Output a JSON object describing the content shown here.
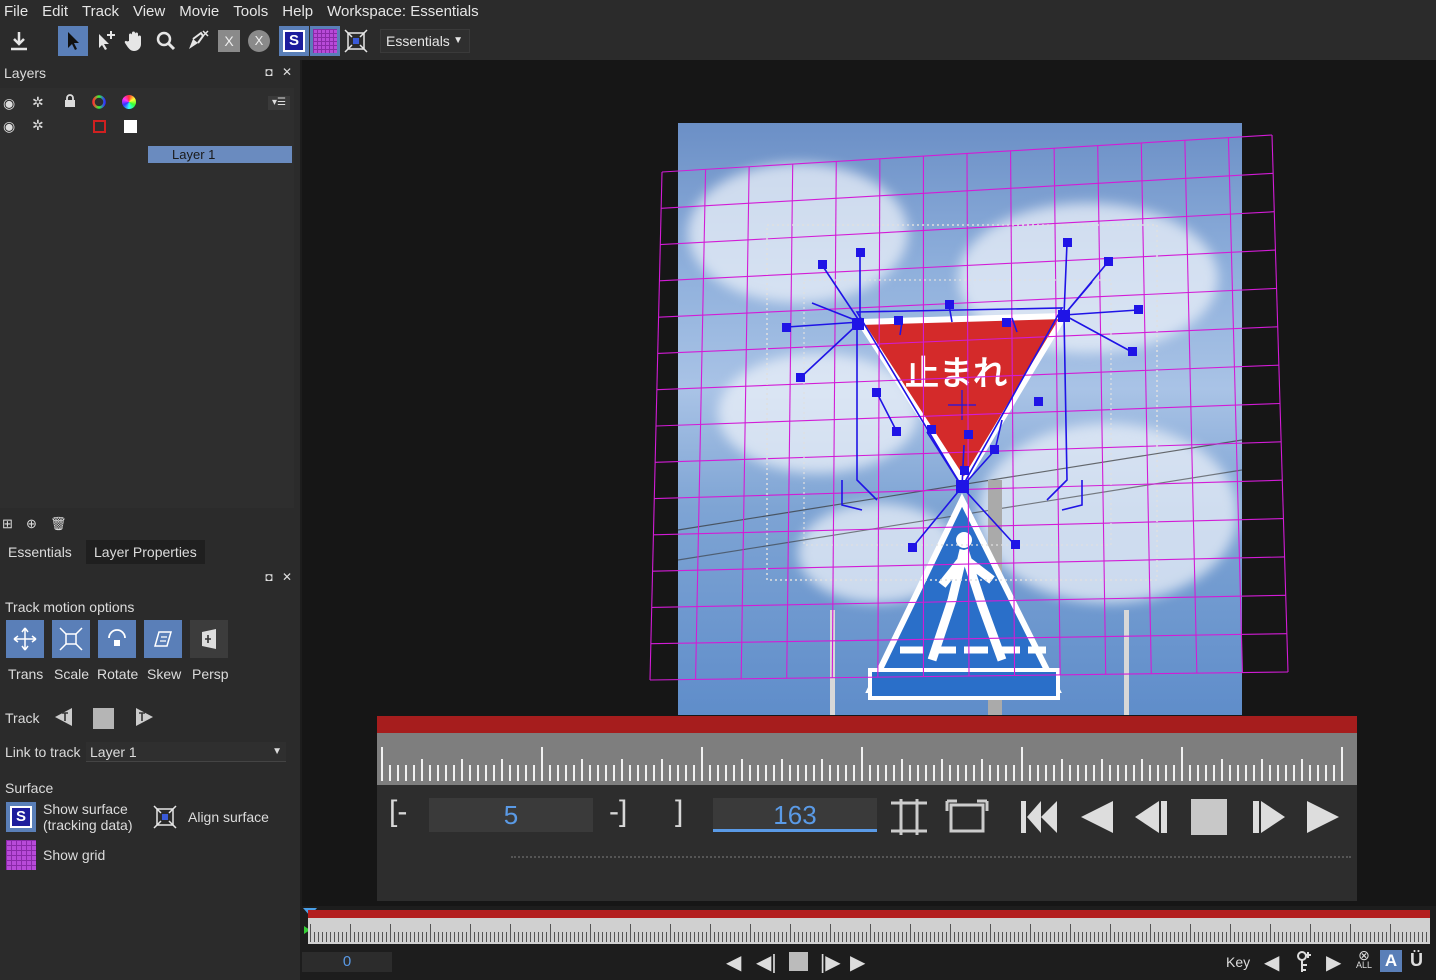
{
  "menu": {
    "file": "File",
    "edit": "Edit",
    "track": "Track",
    "view": "View",
    "movie": "Movie",
    "tools": "Tools",
    "help": "Help",
    "workspace": "Workspace: Essentials"
  },
  "toolbar": {
    "workspace_select": "Essentials",
    "icons": [
      "export-icon",
      "select-icon",
      "add-point-icon",
      "hand-icon",
      "zoom-icon",
      "pen-icon",
      "x-square-icon",
      "x-circle-icon",
      "show-surface-icon",
      "show-grid-icon",
      "align-surface-icon"
    ]
  },
  "layers_panel": {
    "title": "Layers",
    "layers": [
      {
        "name": "Layer 1",
        "selected": true
      }
    ]
  },
  "tabs": {
    "essentials": "Essentials",
    "layer_properties": "Layer Properties"
  },
  "track_motion": {
    "section_title": "Track motion options",
    "options": [
      "Trans",
      "Scale",
      "Rotate",
      "Skew",
      "Persp"
    ]
  },
  "track": {
    "label": "Track"
  },
  "link_to_track": {
    "label": "Link to track",
    "value": "Layer 1"
  },
  "surface": {
    "section_title": "Surface",
    "show_surface_line1": "Show surface",
    "show_surface_line2": "(tracking data)",
    "align_surface": "Align surface",
    "show_grid": "Show grid"
  },
  "transport": {
    "in_bracket": "[-",
    "in_value": "5",
    "out_bracket": "-]",
    "close_bracket": "]",
    "current_frame": "163"
  },
  "bottom_bar": {
    "frame": "0",
    "key_label": "Key",
    "all_label": "ALL"
  },
  "colors": {
    "accent": "#5a7fb8",
    "grid": "#d21cd6",
    "tracker": "#1f14e6",
    "timeline_red": "#a61d1d",
    "frame_blue": "#5a9ae6"
  },
  "sign": {
    "text": "止まれ"
  }
}
